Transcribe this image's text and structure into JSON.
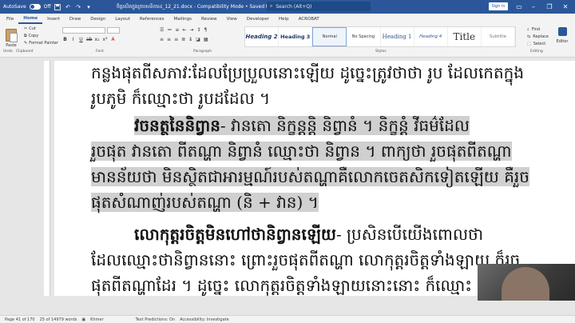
{
  "titlebar": {
    "autosave_label": "AutoSave",
    "autosave_state": "Off",
    "doc_title": "ចិត្តរសិតក្នុងក្របសនិការ៤_12_21.docx  -  Compatibility Mode  •  Saved to this PC",
    "search_placeholder": "Search (Alt+Q)",
    "signin_label": "Sign in"
  },
  "tabs": [
    "File",
    "Home",
    "Insert",
    "Draw",
    "Design",
    "Layout",
    "References",
    "Mailings",
    "Review",
    "View",
    "Developer",
    "Help",
    "ACROBAT"
  ],
  "ribbon": {
    "paste_label": "Paste",
    "cut_label": "Cut",
    "copy_label": "Copy",
    "format_painter_label": "Format Painter",
    "clipboard_group": "Clipboard",
    "font_group": "Font",
    "paragraph_group": "Paragraph",
    "styles_group": "Styles",
    "editing_group": "Editing",
    "find_label": "Find",
    "replace_label": "Replace",
    "select_label": "Select",
    "editor_label": "Editor",
    "undo_label": "Undo",
    "styles": [
      "Heading 2",
      "Heading 3",
      "Normal",
      "No Spacing",
      "Heading 1",
      "Heading 4",
      "Title",
      "Subtitle"
    ]
  },
  "document": {
    "line1": "កន្លងផុតពីសភាវៈដែលប្រែប្រួលនោះឡើយ ដូច្នេះត្រូវថាថា រូប ដែលកេតក្នុង",
    "line2": "រូបភូមិ ក៏ឈ្មោះថា រូបដដែល ។",
    "line3_bold": "វចនត្ថនៃនិព្វាន",
    "line3_rest": "- វានតោ និក្ខន្តន្តិ និព្វានំ ។ និក្ខន្តំ វីធម៌ដែល",
    "line4": "រួចផុត វានតោ ពីតណ្ហា និព្វានំ ឈ្មោះថា និព្វាន ។ ពាក្យថា រួចផុតពីតណ្ហា",
    "line5": "មានន័យថា មិនស្ថិតជាអារម្មណ៍របស់តណ្ហាគឺលោកចេតសិកទៀតឡើយ គឺរួច",
    "line6": "ផុតសំណាញ់របស់តណ្ហា (និ + វាន) ។",
    "line7_bold": "លោកុត្តរចិត្តមិនហៅថានិព្វានឡើយ",
    "line7_rest": "- ប្រសិនបើយើងពោលថា",
    "line8": "ដែលឈ្មោះថានិព្វាននោះ  ព្រោះរួចផុតពីតណ្ហា  លោកុត្តរចិត្តទាំងឡាយ  ក៏រួច",
    "line9": "ផុតពីតណ្ហាដែរ  ។  ដូច្នេះ  លោកុត្តរចិត្តទាំងឡាយនោះនោះ  ក៏ឈ្មោះ"
  },
  "status": {
    "page": "Page 41 of 170",
    "words": "25 of 14979 words",
    "language": "Khmer",
    "predictions": "Text Predictions: On",
    "accessibility": "Accessibility: Investigate"
  }
}
